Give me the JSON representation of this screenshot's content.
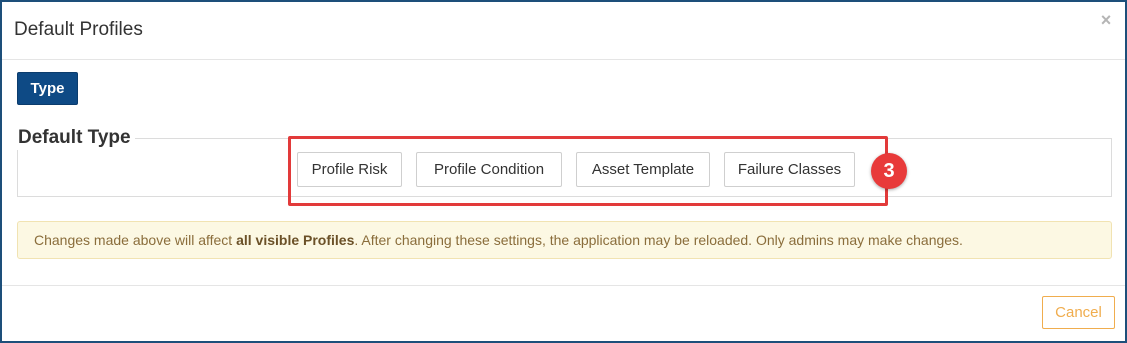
{
  "dialog": {
    "title": "Default Profiles",
    "close_icon": "close-icon"
  },
  "tabs": {
    "type_label": "Type"
  },
  "default_type": {
    "legend": "Default Type",
    "options": [
      {
        "label": "Profile Risk"
      },
      {
        "label": "Profile Condition"
      },
      {
        "label": "Asset Template"
      },
      {
        "label": "Failure Classes"
      }
    ],
    "annotation_badge": "3"
  },
  "alert": {
    "text_before": "Changes made above will affect ",
    "bold_text": "all visible Profiles",
    "text_after": ". After changing these settings, the application may be reloaded. Only admins may make changes."
  },
  "footer": {
    "cancel_label": "Cancel"
  },
  "colors": {
    "primary": "#0e4a85",
    "highlight": "#e23a3a",
    "warning_text": "#8a6d3b",
    "warning_bg": "#fcf8e3",
    "cancel": "#f0ad4e"
  }
}
